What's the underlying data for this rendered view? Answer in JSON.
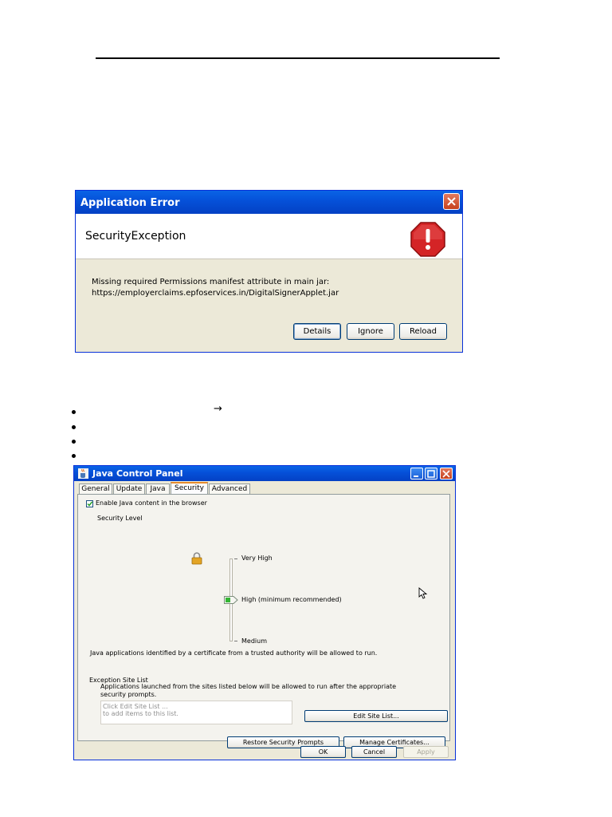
{
  "error_dialog": {
    "title": "Application Error",
    "heading": "SecurityException",
    "message_line1": "Missing required Permissions manifest attribute in main jar:",
    "message_line2": "https://employerclaims.epfoservices.in/DigitalSignerApplet.jar",
    "buttons": {
      "details": "Details",
      "ignore": "Ignore",
      "reload": "Reload"
    }
  },
  "bullets": {
    "arrow_glyph": "→"
  },
  "java_control_panel": {
    "title": "Java Control Panel",
    "tabs": [
      "General",
      "Update",
      "Java",
      "Security",
      "Advanced"
    ],
    "active_tab": "Security",
    "enable_java_label": "Enable Java content in the browser",
    "enable_java_checked": true,
    "security_level_label": "Security Level",
    "levels": {
      "very_high": "Very High",
      "high": "High (minimum recommended)",
      "medium": "Medium"
    },
    "selected_level": "High (minimum recommended)",
    "level_description": "Java applications identified by a certificate from a trusted authority will be allowed to run.",
    "exception_site_list": {
      "heading": "Exception Site List",
      "description_line1": "Applications launched from the sites listed below will be allowed to run after the appropriate",
      "description_line2": "security prompts.",
      "hint_line1": "Click Edit Site List ...",
      "hint_line2": "to add items to this list.",
      "edit_button": "Edit Site List..."
    },
    "buttons": {
      "restore_prompts": "Restore Security Prompts",
      "manage_certificates": "Manage Certificates...",
      "ok": "OK",
      "cancel": "Cancel",
      "apply": "Apply"
    }
  },
  "colors": {
    "xp_title_blue": "#0550d8",
    "xp_face": "#ece9d8",
    "stop_red": "#d42426"
  }
}
